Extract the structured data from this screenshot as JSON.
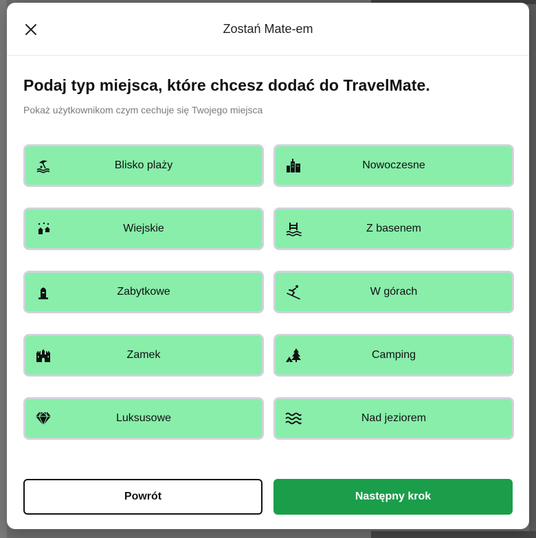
{
  "modal": {
    "title": "Zostań Mate-em",
    "heading": "Podaj typ miejsca, które chcesz dodać do TravelMate.",
    "subtext": "Pokaż użytkownikom czym cechuje się Twojego miejsca"
  },
  "options": [
    {
      "label": "Blisko plaży",
      "icon": "beach-icon"
    },
    {
      "label": "Nowoczesne",
      "icon": "city-buildings-icon"
    },
    {
      "label": "Wiejskie",
      "icon": "countryside-icon"
    },
    {
      "label": "Z basenem",
      "icon": "pool-icon"
    },
    {
      "label": "Zabytkowe",
      "icon": "monument-icon"
    },
    {
      "label": "W górach",
      "icon": "skiing-icon"
    },
    {
      "label": "Zamek",
      "icon": "castle-icon"
    },
    {
      "label": "Camping",
      "icon": "camping-icon"
    },
    {
      "label": "Luksusowe",
      "icon": "diamond-icon"
    },
    {
      "label": "Nad jeziorem",
      "icon": "lake-waves-icon"
    }
  ],
  "footer": {
    "back_label": "Powrót",
    "next_label": "Następny krok"
  },
  "colors": {
    "option_bg": "#88eeaa",
    "option_border": "#cfd3da",
    "primary": "#1a9e4a"
  }
}
